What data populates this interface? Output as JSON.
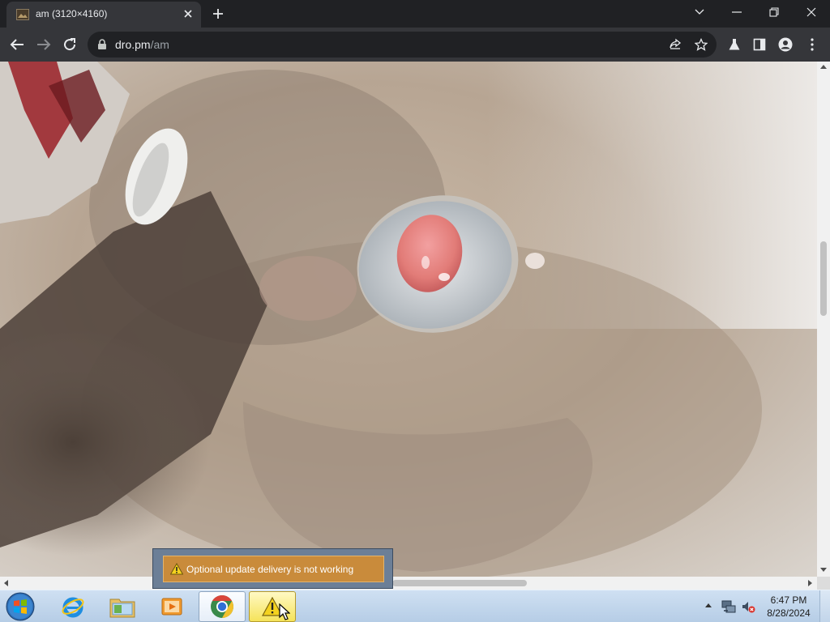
{
  "browser": {
    "tab": {
      "title": "am (3120×4160)",
      "favicon": "image-thumbnail-icon",
      "close_icon": "close-icon"
    },
    "new_tab_icon": "plus-icon",
    "window_controls": [
      "tab-search-icon",
      "minimize-icon",
      "restore-icon",
      "close-icon"
    ],
    "nav": {
      "back_icon": "arrow-left-icon",
      "forward_icon": "arrow-right-icon",
      "reload_icon": "reload-icon"
    },
    "address": {
      "lock_icon": "lock-icon",
      "host": "dro.pm",
      "path": "/am"
    },
    "toolbar_icons": [
      "share-icon",
      "star-icon",
      "labs-flask-icon",
      "side-panel-icon",
      "profile-icon",
      "menu-dots-icon"
    ]
  },
  "page": {
    "content": "image"
  },
  "notification": {
    "icon": "warning-icon",
    "text": "Optional update delivery is not working"
  },
  "taskbar": {
    "start_icon": "windows-start-icon",
    "apps": [
      {
        "name": "internet-explorer-icon",
        "state": "normal"
      },
      {
        "name": "file-explorer-icon",
        "state": "normal"
      },
      {
        "name": "media-player-icon",
        "state": "normal"
      },
      {
        "name": "chrome-icon",
        "state": "active"
      },
      {
        "name": "warning-icon",
        "state": "highlighted"
      }
    ],
    "tray_icons": [
      "show-hidden-icons-icon",
      "network-icon",
      "volume-muted-icon"
    ],
    "time": "6:47 PM",
    "date": "8/28/2024"
  },
  "colors": {
    "chrome_dark": "#202124",
    "chrome_toolbar": "#35363a",
    "notification_bg": "#c98b3b",
    "taskbar": "#c4d8ec"
  }
}
